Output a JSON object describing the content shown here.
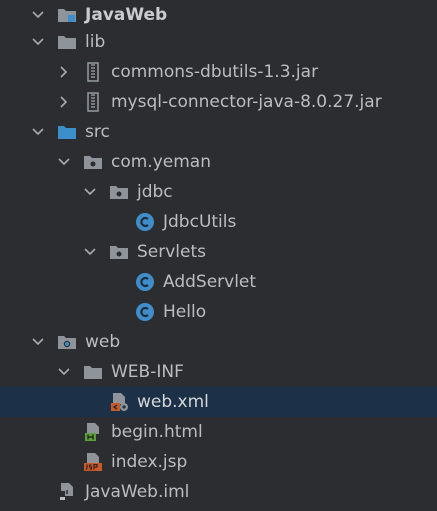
{
  "tree": {
    "items": [
      {
        "label": "JavaWeb",
        "icon": "module-folder-icon",
        "expanded": true
      },
      {
        "label": "lib",
        "icon": "folder-icon",
        "expanded": true
      },
      {
        "label": "commons-dbutils-1.3.jar",
        "icon": "jar-icon",
        "expanded": false
      },
      {
        "label": "mysql-connector-java-8.0.27.jar",
        "icon": "jar-icon",
        "expanded": false
      },
      {
        "label": "src",
        "icon": "source-folder-icon",
        "expanded": true
      },
      {
        "label": "com.yeman",
        "icon": "package-icon",
        "expanded": true
      },
      {
        "label": "jdbc",
        "icon": "package-icon",
        "expanded": true
      },
      {
        "label": "JdbcUtils",
        "icon": "class-icon"
      },
      {
        "label": "Servlets",
        "icon": "package-icon",
        "expanded": true
      },
      {
        "label": "AddServlet",
        "icon": "class-icon"
      },
      {
        "label": "Hello",
        "icon": "class-icon"
      },
      {
        "label": "web",
        "icon": "web-folder-icon",
        "expanded": true
      },
      {
        "label": "WEB-INF",
        "icon": "folder-icon",
        "expanded": true
      },
      {
        "label": "web.xml",
        "icon": "xml-file-icon",
        "selected": true
      },
      {
        "label": "begin.html",
        "icon": "html-file-icon"
      },
      {
        "label": "index.jsp",
        "icon": "jsp-file-icon"
      },
      {
        "label": "JavaWeb.iml",
        "icon": "iml-file-icon"
      }
    ]
  },
  "colors": {
    "background": "#2b2d30",
    "selected_row": "#1c3147",
    "text": "#bbbdc0",
    "folder": "#8f949a",
    "source_folder": "#3d8fc9",
    "class_icon": "#3f8ecb",
    "html_badge": "#5d9e3d",
    "jsp_badge": "#c75a28"
  }
}
